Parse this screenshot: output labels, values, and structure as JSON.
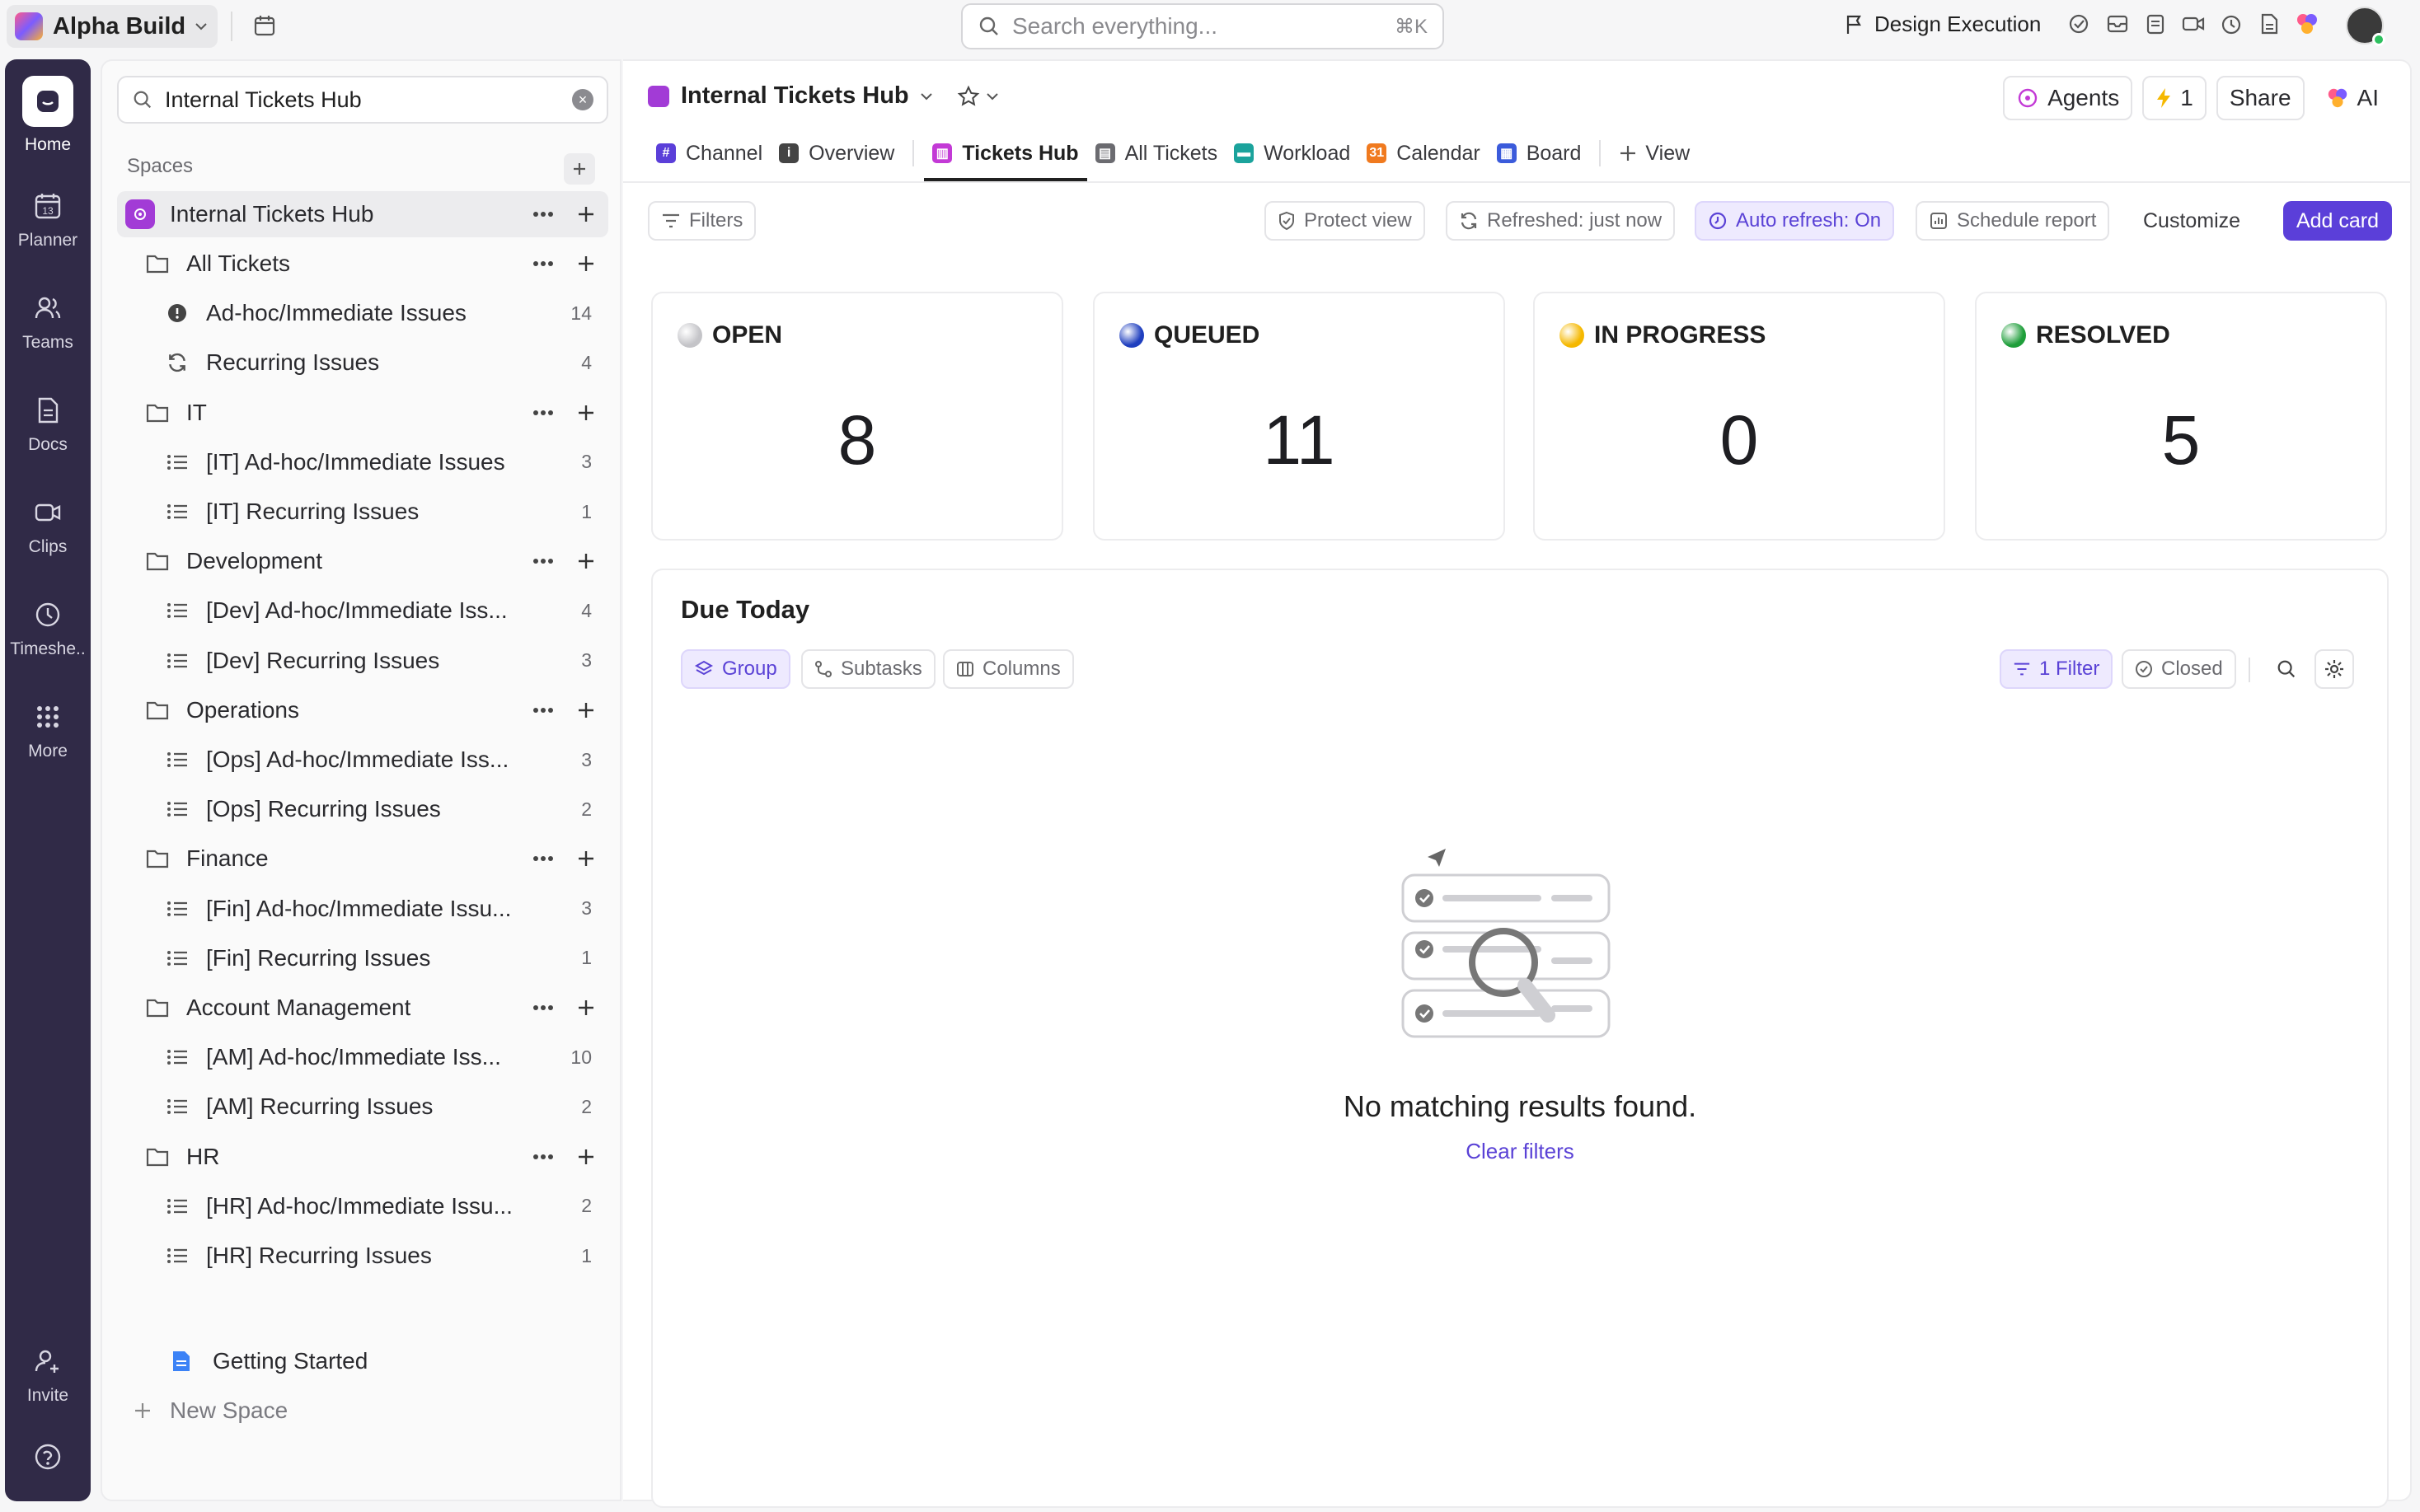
{
  "workspace": {
    "name": "Alpha Build"
  },
  "search": {
    "placeholder": "Search everything...",
    "shortcut": "⌘K"
  },
  "topbar": {
    "design_execution": "Design Execution"
  },
  "rail": {
    "items": [
      {
        "label": "Home",
        "icon": "home-icon"
      },
      {
        "label": "Planner",
        "icon": "planner-icon"
      },
      {
        "label": "Teams",
        "icon": "teams-icon"
      },
      {
        "label": "Docs",
        "icon": "docs-icon"
      },
      {
        "label": "Clips",
        "icon": "clips-icon"
      },
      {
        "label": "Timeshe..",
        "icon": "clock-icon"
      },
      {
        "label": "More",
        "icon": "grid-icon"
      }
    ],
    "invite": "Invite"
  },
  "sidebar": {
    "search_value": "Internal Tickets Hub",
    "spaces_heading": "Spaces",
    "space_name": "Internal Tickets Hub",
    "tree": [
      {
        "type": "folder",
        "label": "All Tickets"
      },
      {
        "type": "list",
        "icon": "alert",
        "label": "Ad-hoc/Immediate Issues",
        "count": "14"
      },
      {
        "type": "list",
        "icon": "recurring",
        "label": "Recurring Issues",
        "count": "4"
      },
      {
        "type": "folder",
        "label": "IT"
      },
      {
        "type": "list",
        "icon": "list",
        "label": "[IT] Ad-hoc/Immediate Issues",
        "count": "3"
      },
      {
        "type": "list",
        "icon": "list",
        "label": "[IT] Recurring Issues",
        "count": "1"
      },
      {
        "type": "folder",
        "label": "Development"
      },
      {
        "type": "list",
        "icon": "list",
        "label": "[Dev] Ad-hoc/Immediate Iss...",
        "count": "4"
      },
      {
        "type": "list",
        "icon": "list",
        "label": "[Dev] Recurring Issues",
        "count": "3"
      },
      {
        "type": "folder",
        "label": "Operations"
      },
      {
        "type": "list",
        "icon": "list",
        "label": "[Ops] Ad-hoc/Immediate Iss...",
        "count": "3"
      },
      {
        "type": "list",
        "icon": "list",
        "label": "[Ops] Recurring Issues",
        "count": "2"
      },
      {
        "type": "folder",
        "label": "Finance"
      },
      {
        "type": "list",
        "icon": "list",
        "label": "[Fin] Ad-hoc/Immediate Issu...",
        "count": "3"
      },
      {
        "type": "list",
        "icon": "list",
        "label": "[Fin] Recurring Issues",
        "count": "1"
      },
      {
        "type": "folder",
        "label": "Account Management"
      },
      {
        "type": "list",
        "icon": "list",
        "label": "[AM] Ad-hoc/Immediate Iss...",
        "count": "10"
      },
      {
        "type": "list",
        "icon": "list",
        "label": "[AM] Recurring Issues",
        "count": "2"
      },
      {
        "type": "folder",
        "label": "HR"
      },
      {
        "type": "list",
        "icon": "list",
        "label": "[HR] Ad-hoc/Immediate Issu...",
        "count": "2"
      },
      {
        "type": "list",
        "icon": "list",
        "label": "[HR] Recurring Issues",
        "count": "1"
      }
    ],
    "getting_started": "Getting Started",
    "new_space": "New Space"
  },
  "main": {
    "title": "Internal Tickets Hub",
    "agents": "Agents",
    "bolt_count": "1",
    "share": "Share",
    "ai": "AI",
    "tabs": [
      {
        "label": "Channel"
      },
      {
        "label": "Overview"
      },
      {
        "label": "Tickets Hub"
      },
      {
        "label": "All Tickets"
      },
      {
        "label": "Workload"
      },
      {
        "label": "Calendar"
      },
      {
        "label": "Board"
      },
      {
        "label": "View"
      }
    ],
    "toolbar": {
      "filters": "Filters",
      "protect": "Protect view",
      "refreshed": "Refreshed: just now",
      "auto_refresh": "Auto refresh: On",
      "schedule": "Schedule report",
      "customize": "Customize",
      "add_card": "Add card"
    },
    "status_cards": [
      {
        "label": "OPEN",
        "value": "8",
        "color": "#c4c4c8"
      },
      {
        "label": "QUEUED",
        "value": "11",
        "color": "#1f3fbf"
      },
      {
        "label": "IN PROGRESS",
        "value": "0",
        "color": "#f5b800"
      },
      {
        "label": "RESOLVED",
        "value": "5",
        "color": "#1e9e3a"
      }
    ],
    "due": {
      "title": "Due Today",
      "group": "Group",
      "subtasks": "Subtasks",
      "columns": "Columns",
      "filter": "1 Filter",
      "closed": "Closed",
      "empty": "No matching results found.",
      "clear": "Clear filters"
    }
  }
}
